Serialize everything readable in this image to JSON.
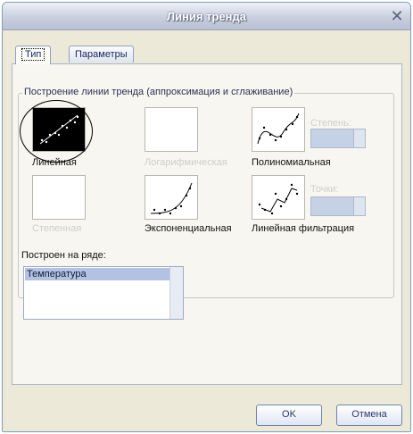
{
  "window": {
    "title": "Линия тренда"
  },
  "tabs": [
    {
      "label": "Тип"
    },
    {
      "label": "Параметры"
    }
  ],
  "group": {
    "title": "Построение линии тренда (аппроксимация и сглаживание)",
    "types": [
      {
        "label": "Линейная",
        "selected": true,
        "enabled": true,
        "icon": "linear-trend-icon"
      },
      {
        "label": "Логарифмическая",
        "selected": false,
        "enabled": false,
        "icon": "logarithmic-trend-icon"
      },
      {
        "label": "Полиномиальная",
        "selected": false,
        "enabled": true,
        "icon": "polynomial-trend-icon"
      },
      {
        "label": "Степенная",
        "selected": false,
        "enabled": false,
        "icon": "power-trend-icon"
      },
      {
        "label": "Экспоненциальная",
        "selected": false,
        "enabled": true,
        "icon": "exponential-trend-icon"
      },
      {
        "label": "Линейная фильтрация",
        "selected": false,
        "enabled": true,
        "icon": "moving-average-icon"
      }
    ],
    "degree_label": "Степень:",
    "points_label": "Точки:"
  },
  "series": {
    "label": "Построен на ряде:",
    "items": [
      "Температура"
    ]
  },
  "buttons": {
    "ok": "OK",
    "cancel": "Отмена"
  }
}
